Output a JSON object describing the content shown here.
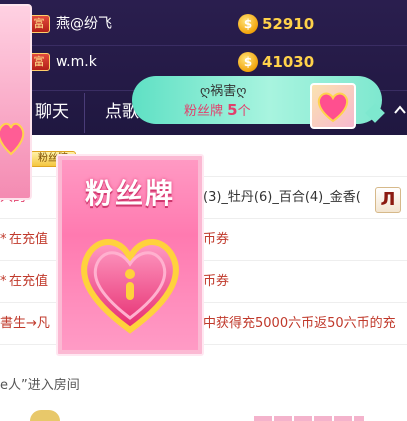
{
  "ranking": [
    {
      "badge": "富",
      "name": "燕@纷飞",
      "coin_icon": "coin-icon",
      "coins": "52910"
    },
    {
      "badge": "富",
      "name": "w.m.k",
      "coin_icon": "coin-icon",
      "coins": "41030"
    }
  ],
  "tabs": [
    {
      "label": "聊天"
    },
    {
      "label": "点歌"
    }
  ],
  "fan_badge_popup": {
    "user": "ღ祸害ღ",
    "label": "粉丝牌",
    "count": "5",
    "unit": "个",
    "icon": "heart-badge-icon"
  },
  "fan_card": {
    "title": "粉丝牌",
    "icon": "heart-icon"
  },
  "chat": {
    "messages": [
      {
        "fan_tag": "粉丝牌",
        "text": "",
        "color": "#c0392b"
      },
      {
        "text": "(3)_牡丹(6)_百合(4)_金香(",
        "color": "#333333"
      },
      {
        "text": "在充值",
        "text_right": "币券",
        "color": "#c0392b"
      },
      {
        "text": "在充值",
        "text_right": "币券",
        "color": "#c0392b"
      },
      {
        "text": "書生→凡",
        "text_right": "中获得充5000六币返50六币的充",
        "color": "#c0392b"
      },
      {
        "text": "e人”进入房间",
        "color": "#555555"
      }
    ],
    "gift_icon": "gift-icon"
  },
  "colors": {
    "panel_bg": "#2a1e4e",
    "coin_text": "#ffd24a",
    "popup_bg": "#5fe0c4",
    "card_pink": "#ff7ab0",
    "system_red": "#c0392b"
  }
}
